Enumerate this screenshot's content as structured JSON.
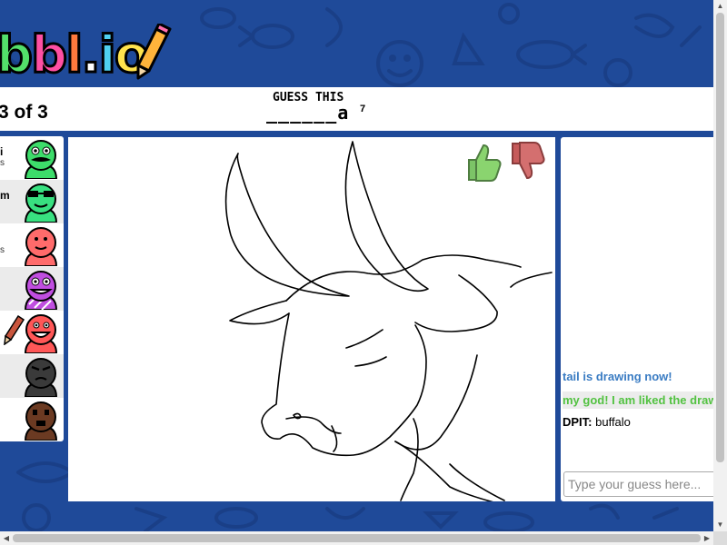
{
  "logo": {
    "text": "bbl.io"
  },
  "header": {
    "round_text": "3 of 3",
    "guess_label": "GUESS THIS",
    "word_hint": "______a",
    "word_length": "7"
  },
  "players": [
    {
      "name": "i",
      "score": "s",
      "avatar_color": "#3ddc6a",
      "eyes": "mustache"
    },
    {
      "name": "m",
      "score": "",
      "avatar_color": "#38e080",
      "eyes": "sunglasses"
    },
    {
      "name": "",
      "score": "s",
      "avatar_color": "#ff6b6b",
      "eyes": "normal"
    },
    {
      "name": "",
      "score": "",
      "avatar_color": "#c04ee0",
      "eyes": "normal"
    },
    {
      "name": "",
      "score": "",
      "avatar_color": "#ff5757",
      "eyes": "normal",
      "drawing": true
    },
    {
      "name": "",
      "score": "",
      "avatar_color": "#3a3a3a",
      "eyes": "sad"
    },
    {
      "name": "",
      "score": "",
      "avatar_color": "#6b3a22",
      "eyes": "square"
    }
  ],
  "canvas": {
    "vote_up_icon": "thumbs-up-icon",
    "vote_down_icon": "thumbs-down-icon"
  },
  "chat": {
    "messages": [
      {
        "text": "tail is drawing now!",
        "color": "#3a7cc3"
      },
      {
        "text": "my god! I am liked the drawing",
        "color": "#52c241"
      },
      {
        "author": "DPIT:",
        "text": " buffalo"
      }
    ],
    "input_placeholder": "Type your guess here..."
  }
}
